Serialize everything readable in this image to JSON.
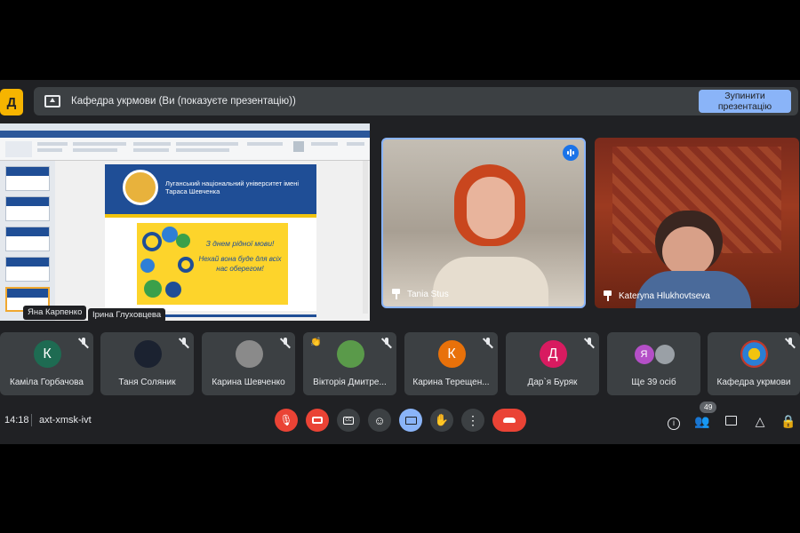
{
  "header": {
    "logo_text": "Д",
    "presenting_title": "Кафедра укрмови (Ви (показуєте презентацію))",
    "stop_button": "Зупинити презентацію"
  },
  "slide": {
    "university": "Луганський національний університет імені Тараса Шевченка",
    "greeting_line1": "З днем рідної мови!",
    "greeting_line2": "Нехай вона буде для всіх нас оберегом!"
  },
  "overlay_names": [
    "Яна Карпенко",
    "Ірина Глуховцева"
  ],
  "videos": [
    {
      "name": "Tania Stus",
      "speaking": true
    },
    {
      "name": "Kateryna Hlukhovtseva",
      "speaking": false
    }
  ],
  "participants": [
    {
      "name": "Каміла Горбачова",
      "initial": "К",
      "color": "#1e6b52"
    },
    {
      "name": "Таня Соляник",
      "initial": "",
      "color": "#1b2230"
    },
    {
      "name": "Карина Шевченко",
      "initial": "",
      "color": "#8a8a8a"
    },
    {
      "name": "Вікторія Дмитре...",
      "initial": "",
      "color": "#5a9a4a"
    },
    {
      "name": "Карина Терещен...",
      "initial": "К",
      "color": "#e8710a"
    },
    {
      "name": "Дар`я Буряк",
      "initial": "Д",
      "color": "#d81b60"
    },
    {
      "name": "Ще 39 осіб",
      "initial": "Я",
      "color": "#b44fc7"
    },
    {
      "name": "Кафедра укрмови",
      "initial": "",
      "color": "#2a7fd4"
    }
  ],
  "footer": {
    "time": "14:18",
    "meeting_code": "axt-xmsk-ivt",
    "people_count": "49"
  },
  "colors": {
    "accent_blue": "#8ab4f8",
    "end_call_red": "#ea4335",
    "tile_bg": "#3c4043",
    "logo_yellow": "#f6b400"
  },
  "icons": [
    "present-icon",
    "mic-off-icon",
    "camera-off-icon",
    "captions-icon",
    "emoji-icon",
    "present-now-icon",
    "raise-hand-icon",
    "more-icon",
    "end-call-icon",
    "info-icon",
    "people-icon",
    "chat-icon",
    "activities-icon",
    "host-controls-icon"
  ]
}
